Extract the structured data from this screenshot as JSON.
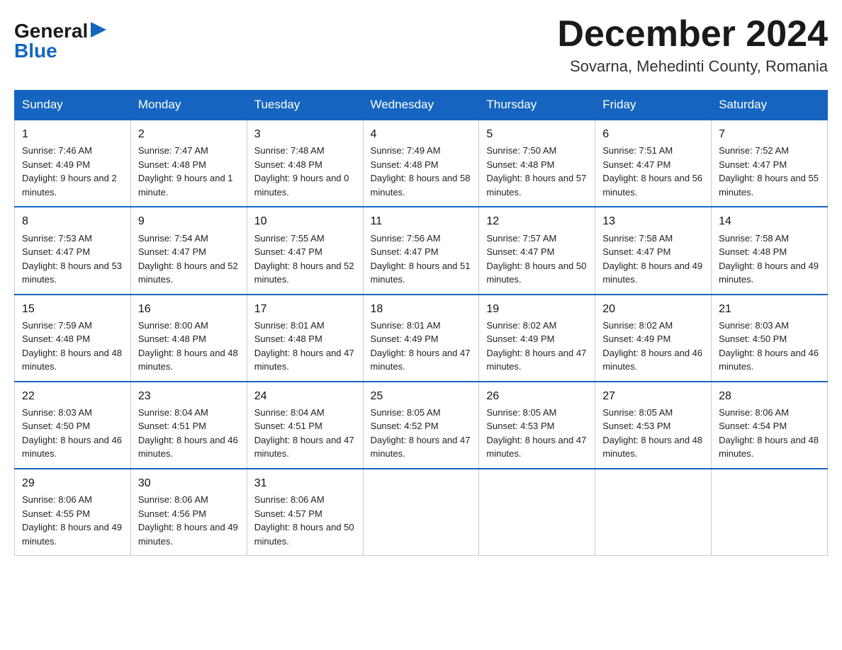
{
  "logo": {
    "general": "General",
    "blue": "Blue"
  },
  "title": {
    "month_year": "December 2024",
    "location": "Sovarna, Mehedinti County, Romania"
  },
  "headers": [
    "Sunday",
    "Monday",
    "Tuesday",
    "Wednesday",
    "Thursday",
    "Friday",
    "Saturday"
  ],
  "weeks": [
    [
      {
        "day": "1",
        "sunrise": "7:46 AM",
        "sunset": "4:49 PM",
        "daylight": "9 hours and 2 minutes."
      },
      {
        "day": "2",
        "sunrise": "7:47 AM",
        "sunset": "4:48 PM",
        "daylight": "9 hours and 1 minute."
      },
      {
        "day": "3",
        "sunrise": "7:48 AM",
        "sunset": "4:48 PM",
        "daylight": "9 hours and 0 minutes."
      },
      {
        "day": "4",
        "sunrise": "7:49 AM",
        "sunset": "4:48 PM",
        "daylight": "8 hours and 58 minutes."
      },
      {
        "day": "5",
        "sunrise": "7:50 AM",
        "sunset": "4:48 PM",
        "daylight": "8 hours and 57 minutes."
      },
      {
        "day": "6",
        "sunrise": "7:51 AM",
        "sunset": "4:47 PM",
        "daylight": "8 hours and 56 minutes."
      },
      {
        "day": "7",
        "sunrise": "7:52 AM",
        "sunset": "4:47 PM",
        "daylight": "8 hours and 55 minutes."
      }
    ],
    [
      {
        "day": "8",
        "sunrise": "7:53 AM",
        "sunset": "4:47 PM",
        "daylight": "8 hours and 53 minutes."
      },
      {
        "day": "9",
        "sunrise": "7:54 AM",
        "sunset": "4:47 PM",
        "daylight": "8 hours and 52 minutes."
      },
      {
        "day": "10",
        "sunrise": "7:55 AM",
        "sunset": "4:47 PM",
        "daylight": "8 hours and 52 minutes."
      },
      {
        "day": "11",
        "sunrise": "7:56 AM",
        "sunset": "4:47 PM",
        "daylight": "8 hours and 51 minutes."
      },
      {
        "day": "12",
        "sunrise": "7:57 AM",
        "sunset": "4:47 PM",
        "daylight": "8 hours and 50 minutes."
      },
      {
        "day": "13",
        "sunrise": "7:58 AM",
        "sunset": "4:47 PM",
        "daylight": "8 hours and 49 minutes."
      },
      {
        "day": "14",
        "sunrise": "7:58 AM",
        "sunset": "4:48 PM",
        "daylight": "8 hours and 49 minutes."
      }
    ],
    [
      {
        "day": "15",
        "sunrise": "7:59 AM",
        "sunset": "4:48 PM",
        "daylight": "8 hours and 48 minutes."
      },
      {
        "day": "16",
        "sunrise": "8:00 AM",
        "sunset": "4:48 PM",
        "daylight": "8 hours and 48 minutes."
      },
      {
        "day": "17",
        "sunrise": "8:01 AM",
        "sunset": "4:48 PM",
        "daylight": "8 hours and 47 minutes."
      },
      {
        "day": "18",
        "sunrise": "8:01 AM",
        "sunset": "4:49 PM",
        "daylight": "8 hours and 47 minutes."
      },
      {
        "day": "19",
        "sunrise": "8:02 AM",
        "sunset": "4:49 PM",
        "daylight": "8 hours and 47 minutes."
      },
      {
        "day": "20",
        "sunrise": "8:02 AM",
        "sunset": "4:49 PM",
        "daylight": "8 hours and 46 minutes."
      },
      {
        "day": "21",
        "sunrise": "8:03 AM",
        "sunset": "4:50 PM",
        "daylight": "8 hours and 46 minutes."
      }
    ],
    [
      {
        "day": "22",
        "sunrise": "8:03 AM",
        "sunset": "4:50 PM",
        "daylight": "8 hours and 46 minutes."
      },
      {
        "day": "23",
        "sunrise": "8:04 AM",
        "sunset": "4:51 PM",
        "daylight": "8 hours and 46 minutes."
      },
      {
        "day": "24",
        "sunrise": "8:04 AM",
        "sunset": "4:51 PM",
        "daylight": "8 hours and 47 minutes."
      },
      {
        "day": "25",
        "sunrise": "8:05 AM",
        "sunset": "4:52 PM",
        "daylight": "8 hours and 47 minutes."
      },
      {
        "day": "26",
        "sunrise": "8:05 AM",
        "sunset": "4:53 PM",
        "daylight": "8 hours and 47 minutes."
      },
      {
        "day": "27",
        "sunrise": "8:05 AM",
        "sunset": "4:53 PM",
        "daylight": "8 hours and 48 minutes."
      },
      {
        "day": "28",
        "sunrise": "8:06 AM",
        "sunset": "4:54 PM",
        "daylight": "8 hours and 48 minutes."
      }
    ],
    [
      {
        "day": "29",
        "sunrise": "8:06 AM",
        "sunset": "4:55 PM",
        "daylight": "8 hours and 49 minutes."
      },
      {
        "day": "30",
        "sunrise": "8:06 AM",
        "sunset": "4:56 PM",
        "daylight": "8 hours and 49 minutes."
      },
      {
        "day": "31",
        "sunrise": "8:06 AM",
        "sunset": "4:57 PM",
        "daylight": "8 hours and 50 minutes."
      },
      null,
      null,
      null,
      null
    ]
  ]
}
